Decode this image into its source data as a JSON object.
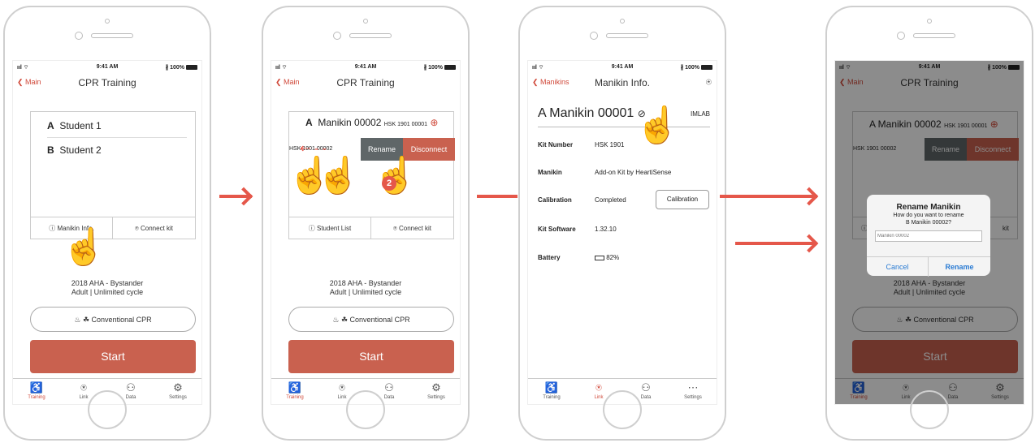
{
  "status": {
    "signal": "ııl ⌔",
    "time": "9:41 AM",
    "battery": "∦ 100%"
  },
  "screen1": {
    "back": "Main",
    "title": "CPR Training",
    "students": [
      {
        "letter": "A",
        "name": "Student 1"
      },
      {
        "letter": "B",
        "name": "Student 2"
      }
    ],
    "manikin_info": "Manikin Info.",
    "connect_kit": "Connect kit",
    "protocol_line1": "2018 AHA - Bystander",
    "protocol_line2": "Adult | Unlimited cycle",
    "cpr_mode": "Conventional CPR",
    "start": "Start"
  },
  "screen2": {
    "back": "Main",
    "title": "CPR Training",
    "manikin_letter": "A",
    "manikin_name": "Manikin 00002",
    "manikin_id": "HSK 1901 00001",
    "swiped_id": "HSK 1901 00002",
    "rename": "Rename",
    "disconnect": "Disconnect",
    "step": "2",
    "student_list": "Student List",
    "connect_kit": "Connect kit",
    "protocol_line1": "2018 AHA - Bystander",
    "protocol_line2": "Adult | Unlimited cycle",
    "cpr_mode": "Conventional CPR",
    "start": "Start"
  },
  "screen3": {
    "back": "Manikins",
    "title": "Manikin Info.",
    "manikin_heading": "A Manikin 00001",
    "brand": "IMLAB",
    "rows": [
      {
        "key": "Kit Number",
        "value": "HSK 1901"
      },
      {
        "key": "Manikin",
        "value": "Add-on Kit by HeartiSense"
      },
      {
        "key": "Calibration",
        "value": "Completed"
      },
      {
        "key": "Kit Software",
        "value": "1.32.10"
      },
      {
        "key": "Battery",
        "value": "82%"
      }
    ],
    "calibration_button": "Calibration"
  },
  "screen4": {
    "back": "Main",
    "title": "CPR Training",
    "manikin_name": "A Manikin 00002",
    "manikin_id": "HSK 1901 00001",
    "swiped_id": "HSK 1901 00002",
    "rename": "Rename",
    "disconnect": "Disconnect",
    "kit_partial": "kit",
    "dialog_title": "Rename Manikin",
    "dialog_msg1": "How do you want to rename",
    "dialog_msg2": "B Manikin 00002?",
    "dialog_placeholder": "Manikin 00002",
    "cancel": "Cancel",
    "rename_btn": "Rename",
    "protocol_line1": "2018 AHA - Bystander",
    "protocol_line2": "Adult | Unlimited cycle",
    "cpr_mode": "Conventional CPR",
    "start": "Start"
  },
  "tabs": [
    "Training",
    "Link",
    "Data",
    "Settings"
  ],
  "colors": {
    "accent": "#d0493a",
    "start": "#c9614f",
    "arrow": "#e5574a",
    "rename_gray": "#5f6668"
  }
}
